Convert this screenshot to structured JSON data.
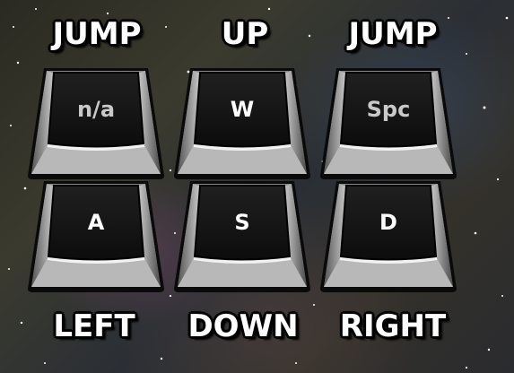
{
  "top_labels": [
    "JUMP",
    "UP",
    "JUMP"
  ],
  "bottom_labels": [
    "LEFT",
    "DOWN",
    "RIGHT"
  ],
  "keys": [
    {
      "key": "n/a",
      "action": "JUMP"
    },
    {
      "key": "W",
      "action": "UP"
    },
    {
      "key": "Spc",
      "action": "JUMP"
    },
    {
      "key": "A",
      "action": "LEFT"
    },
    {
      "key": "S",
      "action": "DOWN"
    },
    {
      "key": "D",
      "action": "RIGHT"
    }
  ],
  "colors": {
    "label_text": "#ffffff",
    "label_outline": "#000000",
    "key_face": "#111111",
    "key_body": "#9a9a9a",
    "key_highlight": "#e8e8e8"
  }
}
